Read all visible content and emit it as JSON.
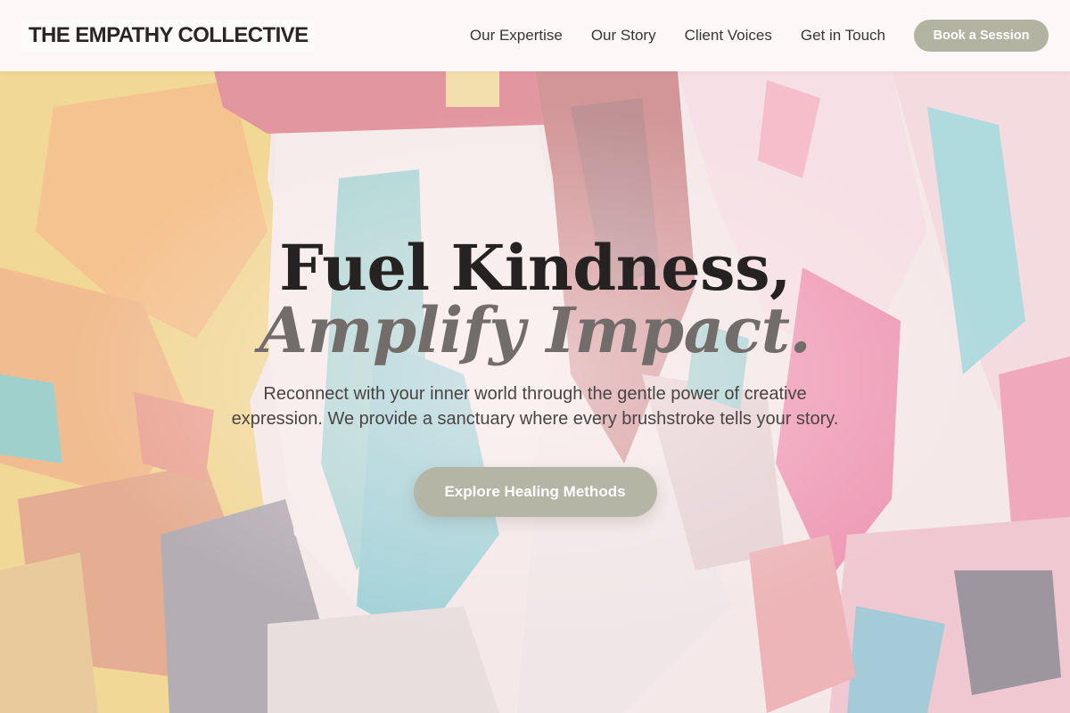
{
  "brand": {
    "name": "THE EMPATHY COLLECTIVE"
  },
  "nav": {
    "items": [
      {
        "label": "Our Expertise"
      },
      {
        "label": "Our Story"
      },
      {
        "label": "Client Voices"
      },
      {
        "label": "Get in Touch"
      }
    ],
    "book_label": "Book a Session"
  },
  "hero": {
    "headline_line1": "Fuel Kindness,",
    "headline_line2": "Amplify Impact.",
    "subtitle": "Reconnect with your inner world through the gentle power of creative expression. We provide a sanctuary where every brushstroke tells your story.",
    "cta_label": "Explore Healing Methods",
    "background": "abstract painted canvas"
  },
  "colors": {
    "button_fill": "#b2b3a1",
    "headline": "#272222",
    "headline_italic": "#726d6a",
    "body_text": "#4a4444"
  }
}
